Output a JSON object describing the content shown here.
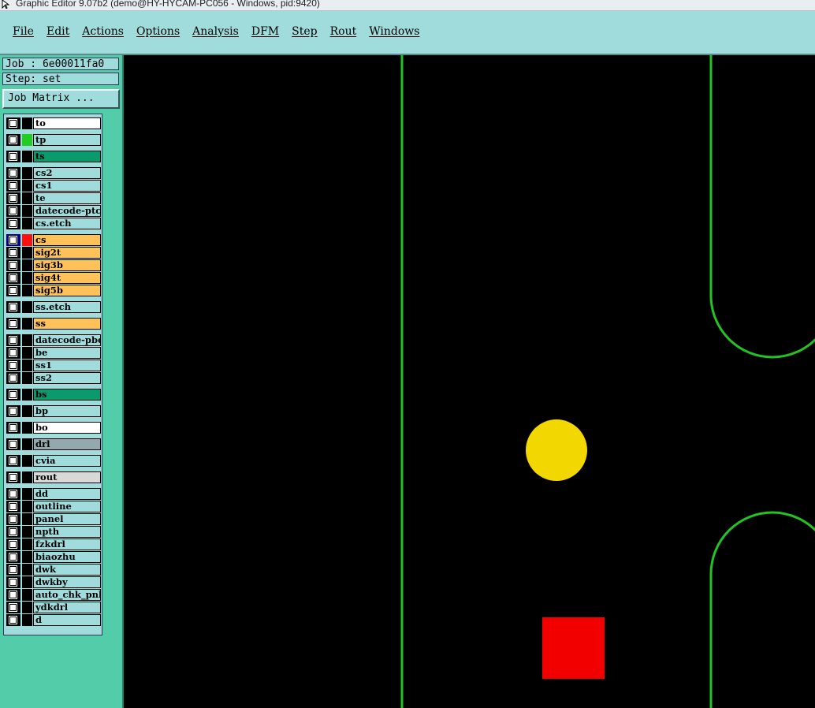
{
  "window": {
    "title": "Graphic Editor 9.07b2 (demo@HY-HYCAM-PC056 - Windows, pid:9420)"
  },
  "menu": [
    "File",
    "Edit",
    "Actions",
    "Options",
    "Analysis",
    "DFM",
    "Step",
    "Rout",
    "Windows"
  ],
  "job": {
    "label": "Job : 6e00011fa0",
    "step": "Step: set",
    "matrix_button": "Job Matrix ..."
  },
  "layers": [
    {
      "name": "to",
      "color": "#ffffff"
    },
    {
      "name": "tp",
      "color": "#a0dcdc",
      "swatch": "#22cc22"
    },
    {
      "name": "ts",
      "color": "#0a9a6c"
    },
    {
      "name": "cs2",
      "color": "#a0dcdc"
    },
    {
      "name": "cs1",
      "color": "#a0dcdc"
    },
    {
      "name": "te",
      "color": "#a0dcdc"
    },
    {
      "name": "datecode-ptc",
      "color": "#a0dcdc"
    },
    {
      "name": "cs.etch",
      "color": "#a0dcdc"
    },
    {
      "name": "cs",
      "color": "#ffc25a",
      "swatch": "#ff1010",
      "active": true
    },
    {
      "name": "sig2t",
      "color": "#ffc25a"
    },
    {
      "name": "sig3b",
      "color": "#ffc25a"
    },
    {
      "name": "sig4t",
      "color": "#ffc25a"
    },
    {
      "name": "sig5b",
      "color": "#ffc25a"
    },
    {
      "name": "ss.etch",
      "color": "#a0dcdc"
    },
    {
      "name": "ss",
      "color": "#ffc25a"
    },
    {
      "name": "datecode-pbc",
      "color": "#a0dcdc"
    },
    {
      "name": "be",
      "color": "#a0dcdc"
    },
    {
      "name": "ss1",
      "color": "#a0dcdc"
    },
    {
      "name": "ss2",
      "color": "#a0dcdc"
    },
    {
      "name": "bs",
      "color": "#0a9a6c"
    },
    {
      "name": "bp",
      "color": "#a0dcdc"
    },
    {
      "name": "bo",
      "color": "#ffffff"
    },
    {
      "name": "drl",
      "color": "#94a8b0"
    },
    {
      "name": "cvia",
      "color": "#a0dcdc"
    },
    {
      "name": "rout",
      "color": "#d8d8d8"
    },
    {
      "name": "dd",
      "color": "#a0dcdc"
    },
    {
      "name": "outline",
      "color": "#a0dcdc"
    },
    {
      "name": "panel",
      "color": "#a0dcdc"
    },
    {
      "name": "npth",
      "color": "#a0dcdc"
    },
    {
      "name": "fzkdrl",
      "color": "#a0dcdc"
    },
    {
      "name": "biaozhu",
      "color": "#a0dcdc"
    },
    {
      "name": "dwk",
      "color": "#a0dcdc"
    },
    {
      "name": "dwkby",
      "color": "#a0dcdc"
    },
    {
      "name": "auto_chk_pnl",
      "color": "#a0dcdc"
    },
    {
      "name": "ydkdrl",
      "color": "#a0dcdc"
    },
    {
      "name": "d",
      "color": "#a0dcdc"
    }
  ],
  "colors": {
    "outline_green": "#22c422",
    "pad_yellow": "#f3d800",
    "pad_red": "#f20000"
  }
}
